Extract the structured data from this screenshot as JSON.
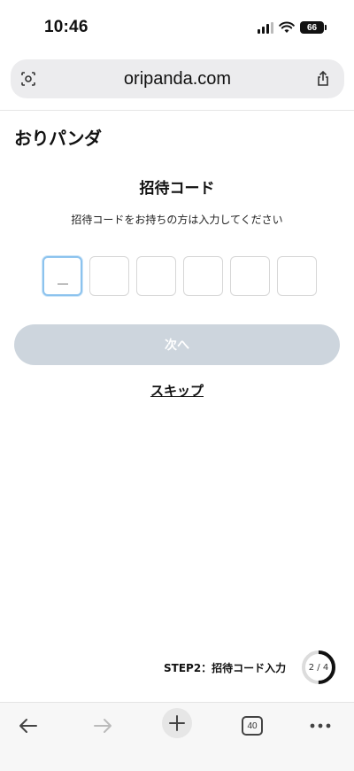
{
  "status": {
    "time": "10:46",
    "battery": "66"
  },
  "browser": {
    "url": "oripanda.com",
    "tabs_count": "40"
  },
  "site": {
    "logo_text": "おりパンダ"
  },
  "form": {
    "title": "招待コード",
    "subtitle": "招待コードをお持ちの方は入力してください",
    "code_boxes": [
      "",
      "",
      "",
      "",
      "",
      ""
    ],
    "next_label": "次へ",
    "skip_label": "スキップ"
  },
  "step": {
    "label": "STEP2：招待コード入力",
    "progress_text": "2 / 4",
    "current": 2,
    "total": 4
  },
  "colors": {
    "accent_border": "#8cc3ee",
    "button_disabled": "#cdd5dd"
  }
}
